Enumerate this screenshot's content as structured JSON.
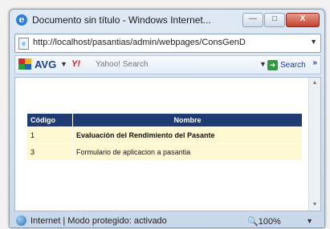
{
  "window": {
    "title": "Documento sin título - Windows Internet...",
    "buttons": {
      "minimize": "—",
      "maximize": "□",
      "close": "X"
    }
  },
  "address": {
    "url": "http://localhost/pasantias/admin/webpages/ConsGenD"
  },
  "toolbar": {
    "avg_label": "AVG",
    "yahoo_label": "Y!",
    "search_placeholder": "Yahoo! Search",
    "search_button": "Search",
    "more": "»"
  },
  "table": {
    "headers": [
      "Código",
      "Nombre"
    ],
    "rows": [
      {
        "code": "1",
        "name": "Evaluación del Rendimiento del Pasante"
      },
      {
        "code": "3",
        "name": "Formulario de aplicacion a pasantia"
      }
    ]
  },
  "status": {
    "text": "Internet | Modo protegido: activado",
    "zoom": "100%"
  },
  "colors": {
    "header_bg": "#1e3c73",
    "row_bg": "#fdf8d2",
    "avg_blue": "#1f3f8f",
    "search_green": "#2e9b3e"
  }
}
